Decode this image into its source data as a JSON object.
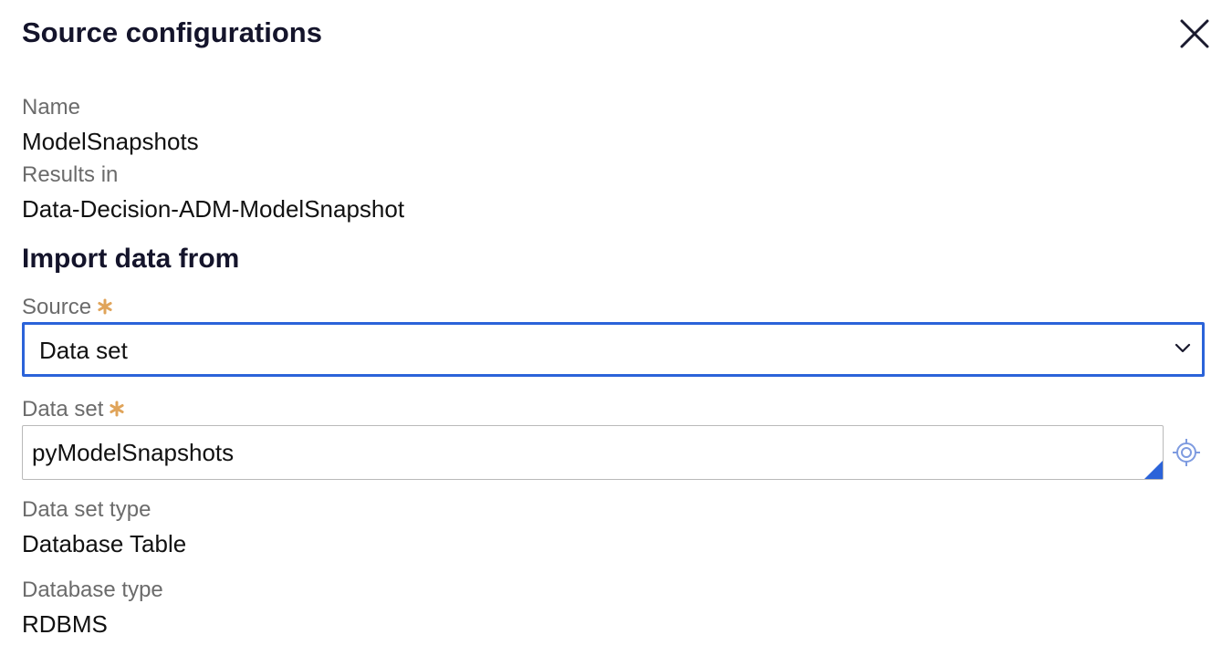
{
  "dialog": {
    "title": "Source configurations",
    "close_icon": "close-icon"
  },
  "details": {
    "name_label": "Name",
    "name_value": "ModelSnapshots",
    "results_label": "Results in",
    "results_value": "Data-Decision-ADM-ModelSnapshot"
  },
  "import": {
    "heading": "Import data from",
    "source_label": "Source",
    "source_value": "Data set",
    "dataset_label": "Data set",
    "dataset_value": "pyModelSnapshots",
    "dataset_type_label": "Data set type",
    "dataset_type_value": "Database Table",
    "database_type_label": "Database type",
    "database_type_value": "RDBMS"
  },
  "icons": {
    "required": "asterisk-icon",
    "dropdown": "chevron-down-icon",
    "lookup": "crosshair-icon"
  },
  "colors": {
    "focus_border": "#2b63d9",
    "required_star": "#e0a45a",
    "label_text": "#6b6b6b",
    "heading_text": "#14142b",
    "lookup_icon": "#7e9be0"
  }
}
